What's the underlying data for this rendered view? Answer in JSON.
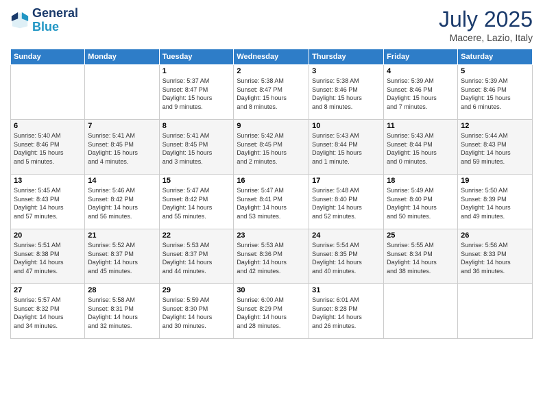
{
  "logo": {
    "line1": "General",
    "line2": "Blue"
  },
  "title": "July 2025",
  "location": "Macere, Lazio, Italy",
  "weekdays": [
    "Sunday",
    "Monday",
    "Tuesday",
    "Wednesday",
    "Thursday",
    "Friday",
    "Saturday"
  ],
  "weeks": [
    [
      {
        "day": "",
        "info": ""
      },
      {
        "day": "",
        "info": ""
      },
      {
        "day": "1",
        "info": "Sunrise: 5:37 AM\nSunset: 8:47 PM\nDaylight: 15 hours\nand 9 minutes."
      },
      {
        "day": "2",
        "info": "Sunrise: 5:38 AM\nSunset: 8:47 PM\nDaylight: 15 hours\nand 8 minutes."
      },
      {
        "day": "3",
        "info": "Sunrise: 5:38 AM\nSunset: 8:46 PM\nDaylight: 15 hours\nand 8 minutes."
      },
      {
        "day": "4",
        "info": "Sunrise: 5:39 AM\nSunset: 8:46 PM\nDaylight: 15 hours\nand 7 minutes."
      },
      {
        "day": "5",
        "info": "Sunrise: 5:39 AM\nSunset: 8:46 PM\nDaylight: 15 hours\nand 6 minutes."
      }
    ],
    [
      {
        "day": "6",
        "info": "Sunrise: 5:40 AM\nSunset: 8:46 PM\nDaylight: 15 hours\nand 5 minutes."
      },
      {
        "day": "7",
        "info": "Sunrise: 5:41 AM\nSunset: 8:45 PM\nDaylight: 15 hours\nand 4 minutes."
      },
      {
        "day": "8",
        "info": "Sunrise: 5:41 AM\nSunset: 8:45 PM\nDaylight: 15 hours\nand 3 minutes."
      },
      {
        "day": "9",
        "info": "Sunrise: 5:42 AM\nSunset: 8:45 PM\nDaylight: 15 hours\nand 2 minutes."
      },
      {
        "day": "10",
        "info": "Sunrise: 5:43 AM\nSunset: 8:44 PM\nDaylight: 15 hours\nand 1 minute."
      },
      {
        "day": "11",
        "info": "Sunrise: 5:43 AM\nSunset: 8:44 PM\nDaylight: 15 hours\nand 0 minutes."
      },
      {
        "day": "12",
        "info": "Sunrise: 5:44 AM\nSunset: 8:43 PM\nDaylight: 14 hours\nand 59 minutes."
      }
    ],
    [
      {
        "day": "13",
        "info": "Sunrise: 5:45 AM\nSunset: 8:43 PM\nDaylight: 14 hours\nand 57 minutes."
      },
      {
        "day": "14",
        "info": "Sunrise: 5:46 AM\nSunset: 8:42 PM\nDaylight: 14 hours\nand 56 minutes."
      },
      {
        "day": "15",
        "info": "Sunrise: 5:47 AM\nSunset: 8:42 PM\nDaylight: 14 hours\nand 55 minutes."
      },
      {
        "day": "16",
        "info": "Sunrise: 5:47 AM\nSunset: 8:41 PM\nDaylight: 14 hours\nand 53 minutes."
      },
      {
        "day": "17",
        "info": "Sunrise: 5:48 AM\nSunset: 8:40 PM\nDaylight: 14 hours\nand 52 minutes."
      },
      {
        "day": "18",
        "info": "Sunrise: 5:49 AM\nSunset: 8:40 PM\nDaylight: 14 hours\nand 50 minutes."
      },
      {
        "day": "19",
        "info": "Sunrise: 5:50 AM\nSunset: 8:39 PM\nDaylight: 14 hours\nand 49 minutes."
      }
    ],
    [
      {
        "day": "20",
        "info": "Sunrise: 5:51 AM\nSunset: 8:38 PM\nDaylight: 14 hours\nand 47 minutes."
      },
      {
        "day": "21",
        "info": "Sunrise: 5:52 AM\nSunset: 8:37 PM\nDaylight: 14 hours\nand 45 minutes."
      },
      {
        "day": "22",
        "info": "Sunrise: 5:53 AM\nSunset: 8:37 PM\nDaylight: 14 hours\nand 44 minutes."
      },
      {
        "day": "23",
        "info": "Sunrise: 5:53 AM\nSunset: 8:36 PM\nDaylight: 14 hours\nand 42 minutes."
      },
      {
        "day": "24",
        "info": "Sunrise: 5:54 AM\nSunset: 8:35 PM\nDaylight: 14 hours\nand 40 minutes."
      },
      {
        "day": "25",
        "info": "Sunrise: 5:55 AM\nSunset: 8:34 PM\nDaylight: 14 hours\nand 38 minutes."
      },
      {
        "day": "26",
        "info": "Sunrise: 5:56 AM\nSunset: 8:33 PM\nDaylight: 14 hours\nand 36 minutes."
      }
    ],
    [
      {
        "day": "27",
        "info": "Sunrise: 5:57 AM\nSunset: 8:32 PM\nDaylight: 14 hours\nand 34 minutes."
      },
      {
        "day": "28",
        "info": "Sunrise: 5:58 AM\nSunset: 8:31 PM\nDaylight: 14 hours\nand 32 minutes."
      },
      {
        "day": "29",
        "info": "Sunrise: 5:59 AM\nSunset: 8:30 PM\nDaylight: 14 hours\nand 30 minutes."
      },
      {
        "day": "30",
        "info": "Sunrise: 6:00 AM\nSunset: 8:29 PM\nDaylight: 14 hours\nand 28 minutes."
      },
      {
        "day": "31",
        "info": "Sunrise: 6:01 AM\nSunset: 8:28 PM\nDaylight: 14 hours\nand 26 minutes."
      },
      {
        "day": "",
        "info": ""
      },
      {
        "day": "",
        "info": ""
      }
    ]
  ]
}
